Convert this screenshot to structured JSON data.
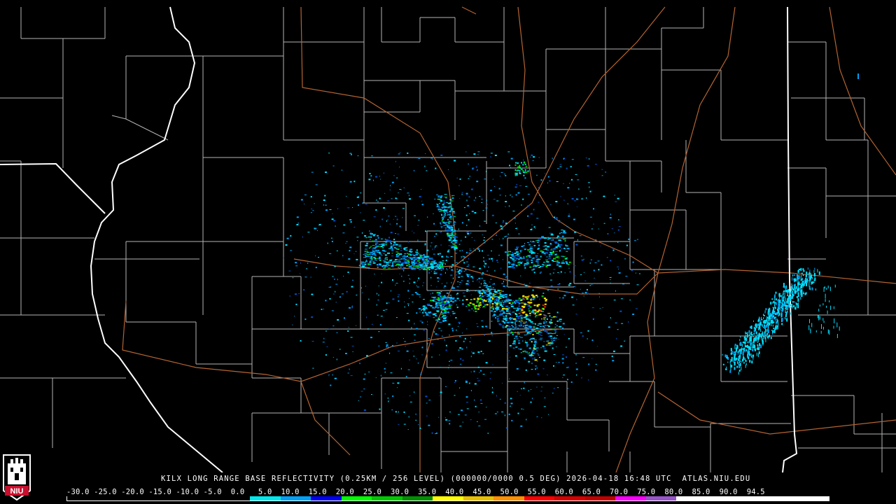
{
  "product": {
    "station": "KILX",
    "caption": "KILX LONG RANGE BASE REFLECTIVITY (0.25KM / 256 LEVEL) (000000/0000 0.5 DEG) 2026-04-18 16:48 UTC  ATLAS.NIU.EDU"
  },
  "legend": {
    "labels": [
      "-30.0",
      "-25.0",
      "-20.0",
      "-15.0",
      "-10.0",
      "-5.0",
      "0.0",
      "5.0",
      "10.0",
      "15.0",
      "20.0",
      "25.0",
      "30.0",
      "35.0",
      "40.0",
      "45.0",
      "50.0",
      "55.0",
      "60.0",
      "65.0",
      "70.0",
      "75.0",
      "80.0",
      "85.0",
      "90.0",
      "94.5"
    ],
    "label_line": "-30.0 -25.0 -20.0 -15.0 -10.0 -5.0  0.0   5.0  10.0  15.0  20.0  25.0  30.0  35.0  40.0  45.0  50.0  55.0  60.0  65.0  70.0  75.0  80.0  85.0  90.0  94.5",
    "colors": [
      "#000000",
      "#000000",
      "#000000",
      "#000000",
      "#000000",
      "#000000",
      "#00e8ec",
      "#00a0f6",
      "#0000f6",
      "#00ff00",
      "#00c800",
      "#009000",
      "#ffff00",
      "#e7c000",
      "#ff9000",
      "#ff0000",
      "#d60000",
      "#c00000",
      "#ff00ff",
      "#9955c9",
      "#ffffff",
      "#ffffff",
      "#ffffff",
      "#ffffff",
      "#ffffff"
    ]
  },
  "logo": {
    "text": "NIU"
  },
  "colors": {
    "background": "#000000",
    "county_lines": "#b4b4b4",
    "state_lines": "#ffffff",
    "highways": "#b46432",
    "echo_light": "#00e0ff",
    "echo_mid": "#00a0f6",
    "echo_dark": "#0050c8",
    "echo_green": "#00d000",
    "echo_yellow": "#f0e000",
    "echo_red": "#e02000"
  }
}
